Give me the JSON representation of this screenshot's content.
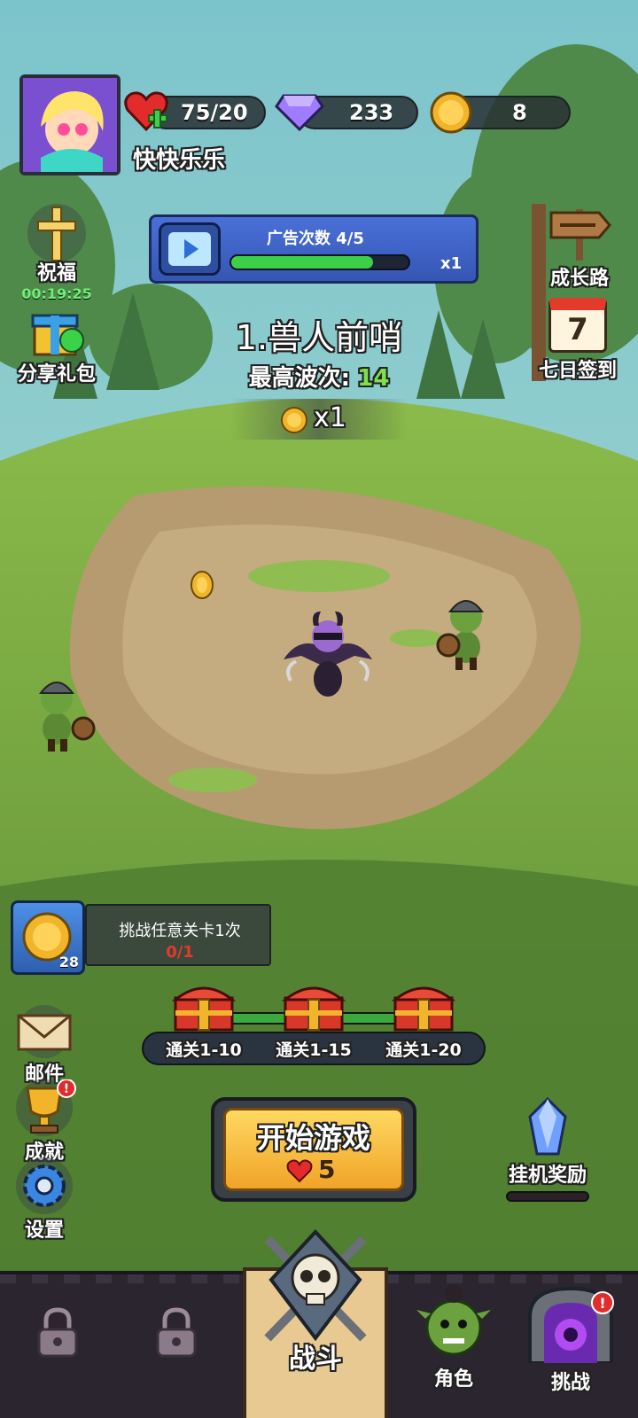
{
  "player": {
    "name": "快快乐乐",
    "energy": "75/20",
    "gems": "233",
    "coins": "8"
  },
  "ad_panel": {
    "label": "广告次数 4/5",
    "progress": 0.8,
    "multiplier": "x1"
  },
  "left_menu": {
    "blessing_label": "祝福",
    "blessing_timer": "00:19:25",
    "share_label": "分享礼包"
  },
  "right_menu": {
    "growth_label": "成长路",
    "seven_day_label": "七日签到",
    "calendar_day": "7"
  },
  "stage": {
    "title": "1.兽人前哨",
    "best_wave_label": "最高波次:",
    "best_wave_value": "14",
    "coin_reward": "x1"
  },
  "quest": {
    "text": "挑战任意关卡1次",
    "progress": "0/1",
    "reward_count": "28"
  },
  "milestones": [
    {
      "label": "通关1-10"
    },
    {
      "label": "通关1-15"
    },
    {
      "label": "通关1-20"
    }
  ],
  "bottom_left": {
    "mail_label": "邮件",
    "achievements_label": "成就",
    "settings_label": "设置"
  },
  "start": {
    "label": "开始游戏",
    "cost": "5"
  },
  "idle_reward": {
    "label": "挂机奖励"
  },
  "nav": {
    "battle_label": "战斗",
    "character_label": "角色",
    "challenge_label": "挑战"
  },
  "colors": {
    "sky": "#7fc3c9",
    "grass": "#6a9a3f",
    "dirt": "#b49a6e",
    "gold_button": "#f2b93a",
    "best_wave_green": "#7ee04a",
    "quest_progress_red": "#e23b2b",
    "nav_bar": "#2b2530"
  }
}
